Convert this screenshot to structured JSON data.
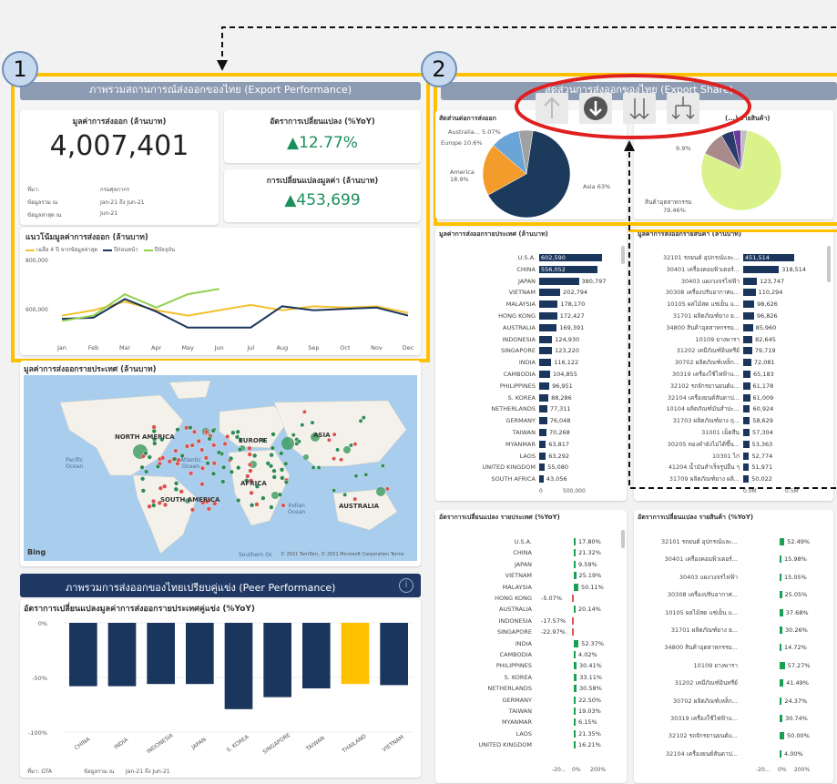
{
  "badges": {
    "one": "1",
    "two": "2"
  },
  "panel1": {
    "header": "ภาพรวมสถานการณ์ส่งออกของไทย (Export Performance)",
    "export_value_title": "มูลค่าการส่งออก (ล้านบาท)",
    "export_value": "4,007,401",
    "source_label": "ที่มา:",
    "source_value": "กรมศุลกากร",
    "period_label": "ข้อมูลรวม ณ",
    "period_value": "Jan-21 ถึง Jun-21",
    "latest_label": "ข้อมูลล่าสุด ณ",
    "latest_value": "Jun-21",
    "yoy_title": "อัตราการเปลี่ยนแปลง (%YoY)",
    "yoy_value": "▲12.77%",
    "chg_title": "การเปลี่ยนแปลงมูลค่า (ล้านบาท)",
    "chg_value": "▲453,699",
    "trend_title": "แนวโน้มมูลค่าการส่งออก (ล้านบาท)",
    "legend": [
      "เฉลี่ย 4 ปี จากข้อมูลล่าสุด",
      "ปีก่อนหน้า",
      "ปีปัจจุบัน"
    ],
    "legend_colors": [
      "#f2c12e",
      "#1b365d",
      "#92d050"
    ],
    "y_ticks": [
      "800,000",
      "600,000"
    ],
    "months": [
      "Jan",
      "Feb",
      "Mar",
      "Apr",
      "May",
      "Jun",
      "Jul",
      "Aug",
      "Sep",
      "Oct",
      "Nov",
      "Dec"
    ]
  },
  "chart_data": [
    {
      "type": "line",
      "title": "แนวโน้มมูลค่าการส่งออก (ล้านบาท)",
      "x": [
        "Jan",
        "Feb",
        "Mar",
        "Apr",
        "May",
        "Jun",
        "Jul",
        "Aug",
        "Sep",
        "Oct",
        "Nov",
        "Dec"
      ],
      "ylim": [
        540000,
        820000
      ],
      "series": [
        {
          "name": "เฉลี่ย 4 ปี จากข้อมูลล่าสุด",
          "values": [
            620000,
            640000,
            672000,
            640000,
            620000,
            640000,
            660000,
            640000,
            655000,
            650000,
            655000,
            630000
          ]
        },
        {
          "name": "ปีก่อนหน้า",
          "values": [
            608000,
            612000,
            682000,
            635000,
            575000,
            575000,
            575000,
            655000,
            640000,
            645000,
            650000,
            620000
          ]
        },
        {
          "name": "ปีปัจจุบัน",
          "values": [
            600000,
            620000,
            700000,
            650000,
            700000,
            720000
          ]
        }
      ]
    },
    {
      "type": "pie",
      "title": "สัดส่วนการส่งออกของไทย (Export Share)",
      "categories": [
        "Asia",
        "America",
        "Europe",
        "Australia..."
      ],
      "values": [
        63,
        18.9,
        10.6,
        5.07
      ]
    },
    {
      "type": "pie",
      "categories": [
        "สินค้าอุตสาหกรรม",
        "other"
      ],
      "values": [
        79.46,
        9.9
      ]
    },
    {
      "type": "bar",
      "title": "มูลค่าการส่งออกรายประเทศ (ล้านบาท)",
      "categories": [
        "U.S.A.",
        "CHINA",
        "JAPAN",
        "VIETNAM",
        "MALAYSIA",
        "HONG KONG",
        "AUSTRALIA",
        "INDONESIA",
        "SINGAPORE",
        "INDIA",
        "CAMBODIA",
        "PHILIPPINES",
        "S. KOREA",
        "NETHERLANDS",
        "GERMANY",
        "TAIWAN",
        "MYANMAR",
        "LAOS",
        "UNITED KINGDOM",
        "SOUTH AFRICA"
      ],
      "values": [
        602590,
        556052,
        380797,
        202794,
        178170,
        172427,
        169391,
        124930,
        123220,
        116122,
        104855,
        96951,
        88286,
        77311,
        76048,
        70268,
        63817,
        63292,
        55080,
        43056
      ],
      "xlim": [
        0,
        700000
      ]
    },
    {
      "type": "bar",
      "title": "มูลค่าการส่งออกรายสินค้า (ล้านบาท)",
      "categories": [
        "32101 รถยนต์ อุปกรณ์และ...",
        "30401 เครื่องคอมพิวเตอร์...",
        "30403 แผงวงจรไฟฟ้า",
        "30308 เครื่องปรับอากาศแ...",
        "10105 ผลไม้สด แช่เย็น แ...",
        "31701 ผลิตภัณฑ์ยาง ย...",
        "34800 สินค้าอุตสาหกรรม...",
        "10109 ยางพารา",
        "31202 เคมีภัณฑ์อินทรีย์",
        "30702 ผลิตภัณฑ์เหล็ก...",
        "30319 เครื่องใช้ไฟฟ้าแ...",
        "32102 รถจักรยานยนต์แ...",
        "32104 เครื่องยนต์สันดาป...",
        "10104 ผลิตภัณฑ์มันสำปะ...",
        "31703 ผลิตภัณฑ์ยาง ถุ...",
        "31001 เม็ดสีน",
        "30205 ทองคำยังไม่ได้ขึ้น...",
        "10301 ไก่",
        "41204 น้ำมันสำเร็จรูปอื่น ๆ",
        "31709 ผลิตภัณฑ์ยาง ผลิ..."
      ],
      "values": [
        451514,
        318514,
        123747,
        110294,
        98626,
        96826,
        85960,
        82645,
        79719,
        72081,
        65183,
        61178,
        61009,
        60924,
        58629,
        57304,
        53363,
        52774,
        51971,
        50022
      ],
      "xlim": [
        0,
        520000
      ]
    },
    {
      "type": "bar",
      "title": "อัตราการเปลี่ยนแปลง รายประเทศ (%YoY)",
      "categories": [
        "U.S.A.",
        "CHINA",
        "JAPAN",
        "VIETNAM",
        "MALAYSIA",
        "HONG KONG",
        "AUSTRALIA",
        "INDONESIA",
        "SINGAPORE",
        "INDIA",
        "CAMBODIA",
        "PHILIPPINES",
        "S. KOREA",
        "NETHERLANDS",
        "GERMANY",
        "TAIWAN",
        "MYANMAR",
        "LAOS",
        "UNITED KINGDOM"
      ],
      "values": [
        17.8,
        21.32,
        9.59,
        25.19,
        50.11,
        -5.07,
        20.14,
        -17.57,
        -22.97,
        52.37,
        4.02,
        30.41,
        33.11,
        30.58,
        22.5,
        19.03,
        6.15,
        21.35,
        16.21
      ]
    },
    {
      "type": "bar",
      "title": "อัตราการเปลี่ยนแปลง รายสินค้า (%YoY)",
      "categories": [
        "32101 รถยนต์ อุปกรณ์และ...",
        "30401 เครื่องคอมพิวเตอร์...",
        "30403 แผงวงจรไฟฟ้า",
        "30308 เครื่องปรับอากาศ...",
        "10105 ผลไม้สด แช่เย็น แ...",
        "31701 ผลิตภัณฑ์ยาง ย...",
        "34800 สินค้าอุตสาหกรรม...",
        "10109 ยางพารา",
        "31202 เคมีภัณฑ์อินทรีย์",
        "30702 ผลิตภัณฑ์เหล็ก...",
        "30319 เครื่องใช้ไฟฟ้าแ...",
        "32102 รถจักรยานยนต์แ...",
        "32104 เครื่องยนต์สันดาป..."
      ],
      "values": [
        52.49,
        15.98,
        15.05,
        25.05,
        37.68,
        30.26,
        14.72,
        57.27,
        41.49,
        24.37,
        30.74,
        50.0,
        4.0
      ]
    },
    {
      "type": "bar",
      "title": "อัตราการเปลี่ยนแปลงมูลค่าการส่งออกรายประเทศคู่แข่ง (%YoY)",
      "categories": [
        "CHINA",
        "INDIA",
        "INDONESIA",
        "JAPAN",
        "S. KOREA",
        "SINGAPORE",
        "TAIWAN",
        "THAILAND",
        "VIETNAM"
      ],
      "values": [
        -58,
        -58,
        -56,
        -56,
        -79,
        -68,
        -60,
        -56,
        -57
      ],
      "ylim": [
        -100,
        0
      ]
    }
  ],
  "panel2": {
    "header": "สัดส่วนการส่งออกของไทย (Export Share)",
    "pie1_title": "สัดส่วนต่อการส่งออก",
    "pie1_labels": {
      "asia": "Asia 63%",
      "america": "America\n18.9%",
      "europe": "Europe 10.6%",
      "australia": "Australia... 5.07%"
    },
    "pie2_title": "(...) รายสินค้า)",
    "pie2_labels": {
      "other": "9.9%",
      "ind": "สินค้าอุตสาหกรรม",
      "ind_pct": "79.46%"
    },
    "toolbar": [
      "up-arrow",
      "down-circle",
      "double-down",
      "expand-hierarchy"
    ]
  },
  "country_value": {
    "title": "มูลค่าการส่งออกรายประเทศ (ล้านบาท)",
    "axis": [
      "0",
      "500,000"
    ]
  },
  "product_value": {
    "title": "มูลค่าการส่งออกรายสินค้า (ล้านบาท)",
    "axis": [
      "0.0M",
      "0.5M"
    ]
  },
  "country_yoy": {
    "title": "อัตราการเปลี่ยนแปลง รายประเทศ (%YoY)",
    "labels": [
      "17.80%",
      "21.32%",
      "9.59%",
      "25.19%",
      "50.11%",
      "-5.07%",
      "20.14%",
      "-17.57%",
      "-22.97%",
      "52.37%",
      "4.02%",
      "30.41%",
      "33.11%",
      "30.58%",
      "22.50%",
      "19.03%",
      "6.15%",
      "21.35%",
      "16.21%"
    ],
    "axis": [
      "-20...",
      "0%",
      "200%"
    ]
  },
  "product_yoy": {
    "title": "อัตราการเปลี่ยนแปลง รายสินค้า (%YoY)",
    "labels": [
      "52.49%",
      "15.98%",
      "15.05%",
      "25.05%",
      "37.68%",
      "30.26%",
      "14.72%",
      "57.27%",
      "41.49%",
      "24.37%",
      "30.74%",
      "50.00%",
      "4.00%"
    ],
    "axis": [
      "-20...",
      "0%",
      "200%"
    ]
  },
  "map": {
    "title": "มูลค่าการส่งออกรายประเทศ (ล้านบาท)",
    "labels": {
      "na": "NORTH AMERICA",
      "eu": "EUROPE",
      "asia": "ASIA",
      "sa": "SOUTH AMERICA",
      "africa": "AFRICA",
      "aus": "AUSTRALIA",
      "pac": "Pacific\nOcean",
      "atl": "Atlantic\nOcean",
      "ind": "Indian\nOcean",
      "south": "Southern Oc"
    },
    "bing": "Bing",
    "copyright": "© 2021 TomTom, © 2021 Microsoft Corporation  Terms"
  },
  "peer": {
    "header": "ภาพรวมการส่งออกของไทยเปรียบคู่แข่ง (Peer Performance)",
    "title": "อัตราการเปลี่ยนแปลงมูลค่าการส่งออกรายประเทศคู่แข่ง (%YoY)",
    "y_ticks": [
      "0%",
      "-50%",
      "-100%"
    ],
    "source": "ที่มา: GTA",
    "period_label": "ข้อมูลรวม ณ",
    "period_value": "Jan-21 ถึง Jun-21",
    "highlight_color": "#ffc000",
    "bar_color": "#1b365d"
  }
}
